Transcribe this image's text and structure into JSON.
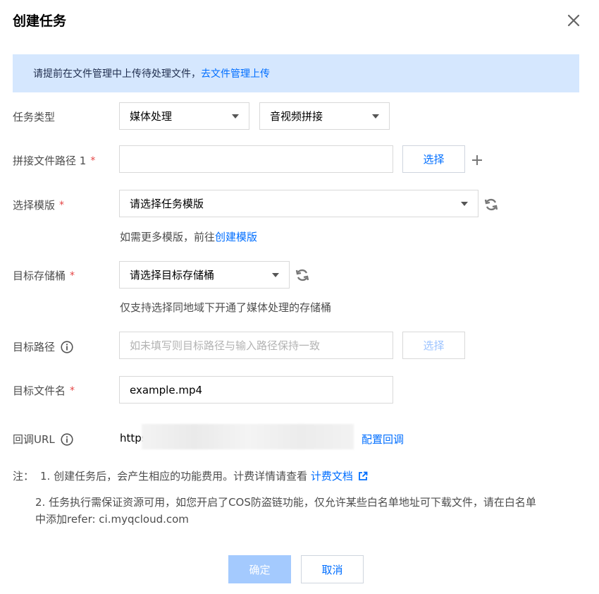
{
  "dialog": {
    "title": "创建任务"
  },
  "notice": {
    "text": "请提前在文件管理中上传待处理文件，",
    "link": "去文件管理上传"
  },
  "task_type": {
    "label": "任务类型",
    "category_value": "媒体处理",
    "subtype_value": "音视频拼接"
  },
  "concat_path": {
    "label": "拼接文件路径 1",
    "required_mark": "*",
    "value": "",
    "select_label": "选择"
  },
  "template": {
    "label": "选择模版",
    "required_mark": "*",
    "placeholder": "请选择任务模版",
    "hint_prefix": "如需更多模版，前往",
    "hint_link": "创建模版"
  },
  "bucket": {
    "label": "目标存储桶",
    "required_mark": "*",
    "placeholder": "请选择目标存储桶",
    "hint": "仅支持选择同地域下开通了媒体处理的存储桶"
  },
  "target_path": {
    "label": "目标路径",
    "placeholder": "如未填写则目标路径与输入路径保持一致",
    "select_label": "选择"
  },
  "target_filename": {
    "label": "目标文件名",
    "required_mark": "*",
    "value": "example.mp4"
  },
  "callback": {
    "label": "回调URL",
    "value_visible": "https",
    "config_link": "配置回调"
  },
  "notes": {
    "prefix": "注：",
    "line1_text": "1. 创建任务后，会产生相应的功能费用。计费详情请查看 ",
    "line1_link": "计费文档",
    "line2a": "2. 任务执行需保证资源可用，如您开启了COS防盗链功能，仅允许某些白名单地址可下载文件，请在白名单",
    "line2b": "中添加refer: ci.myqcloud.com"
  },
  "footer": {
    "confirm_label": "确定",
    "cancel_label": "取消"
  },
  "colors": {
    "accent": "#006eff",
    "required": "#e54545",
    "notice_bg": "#d5e7fe",
    "confirm_disabled": "#a4cafe"
  }
}
